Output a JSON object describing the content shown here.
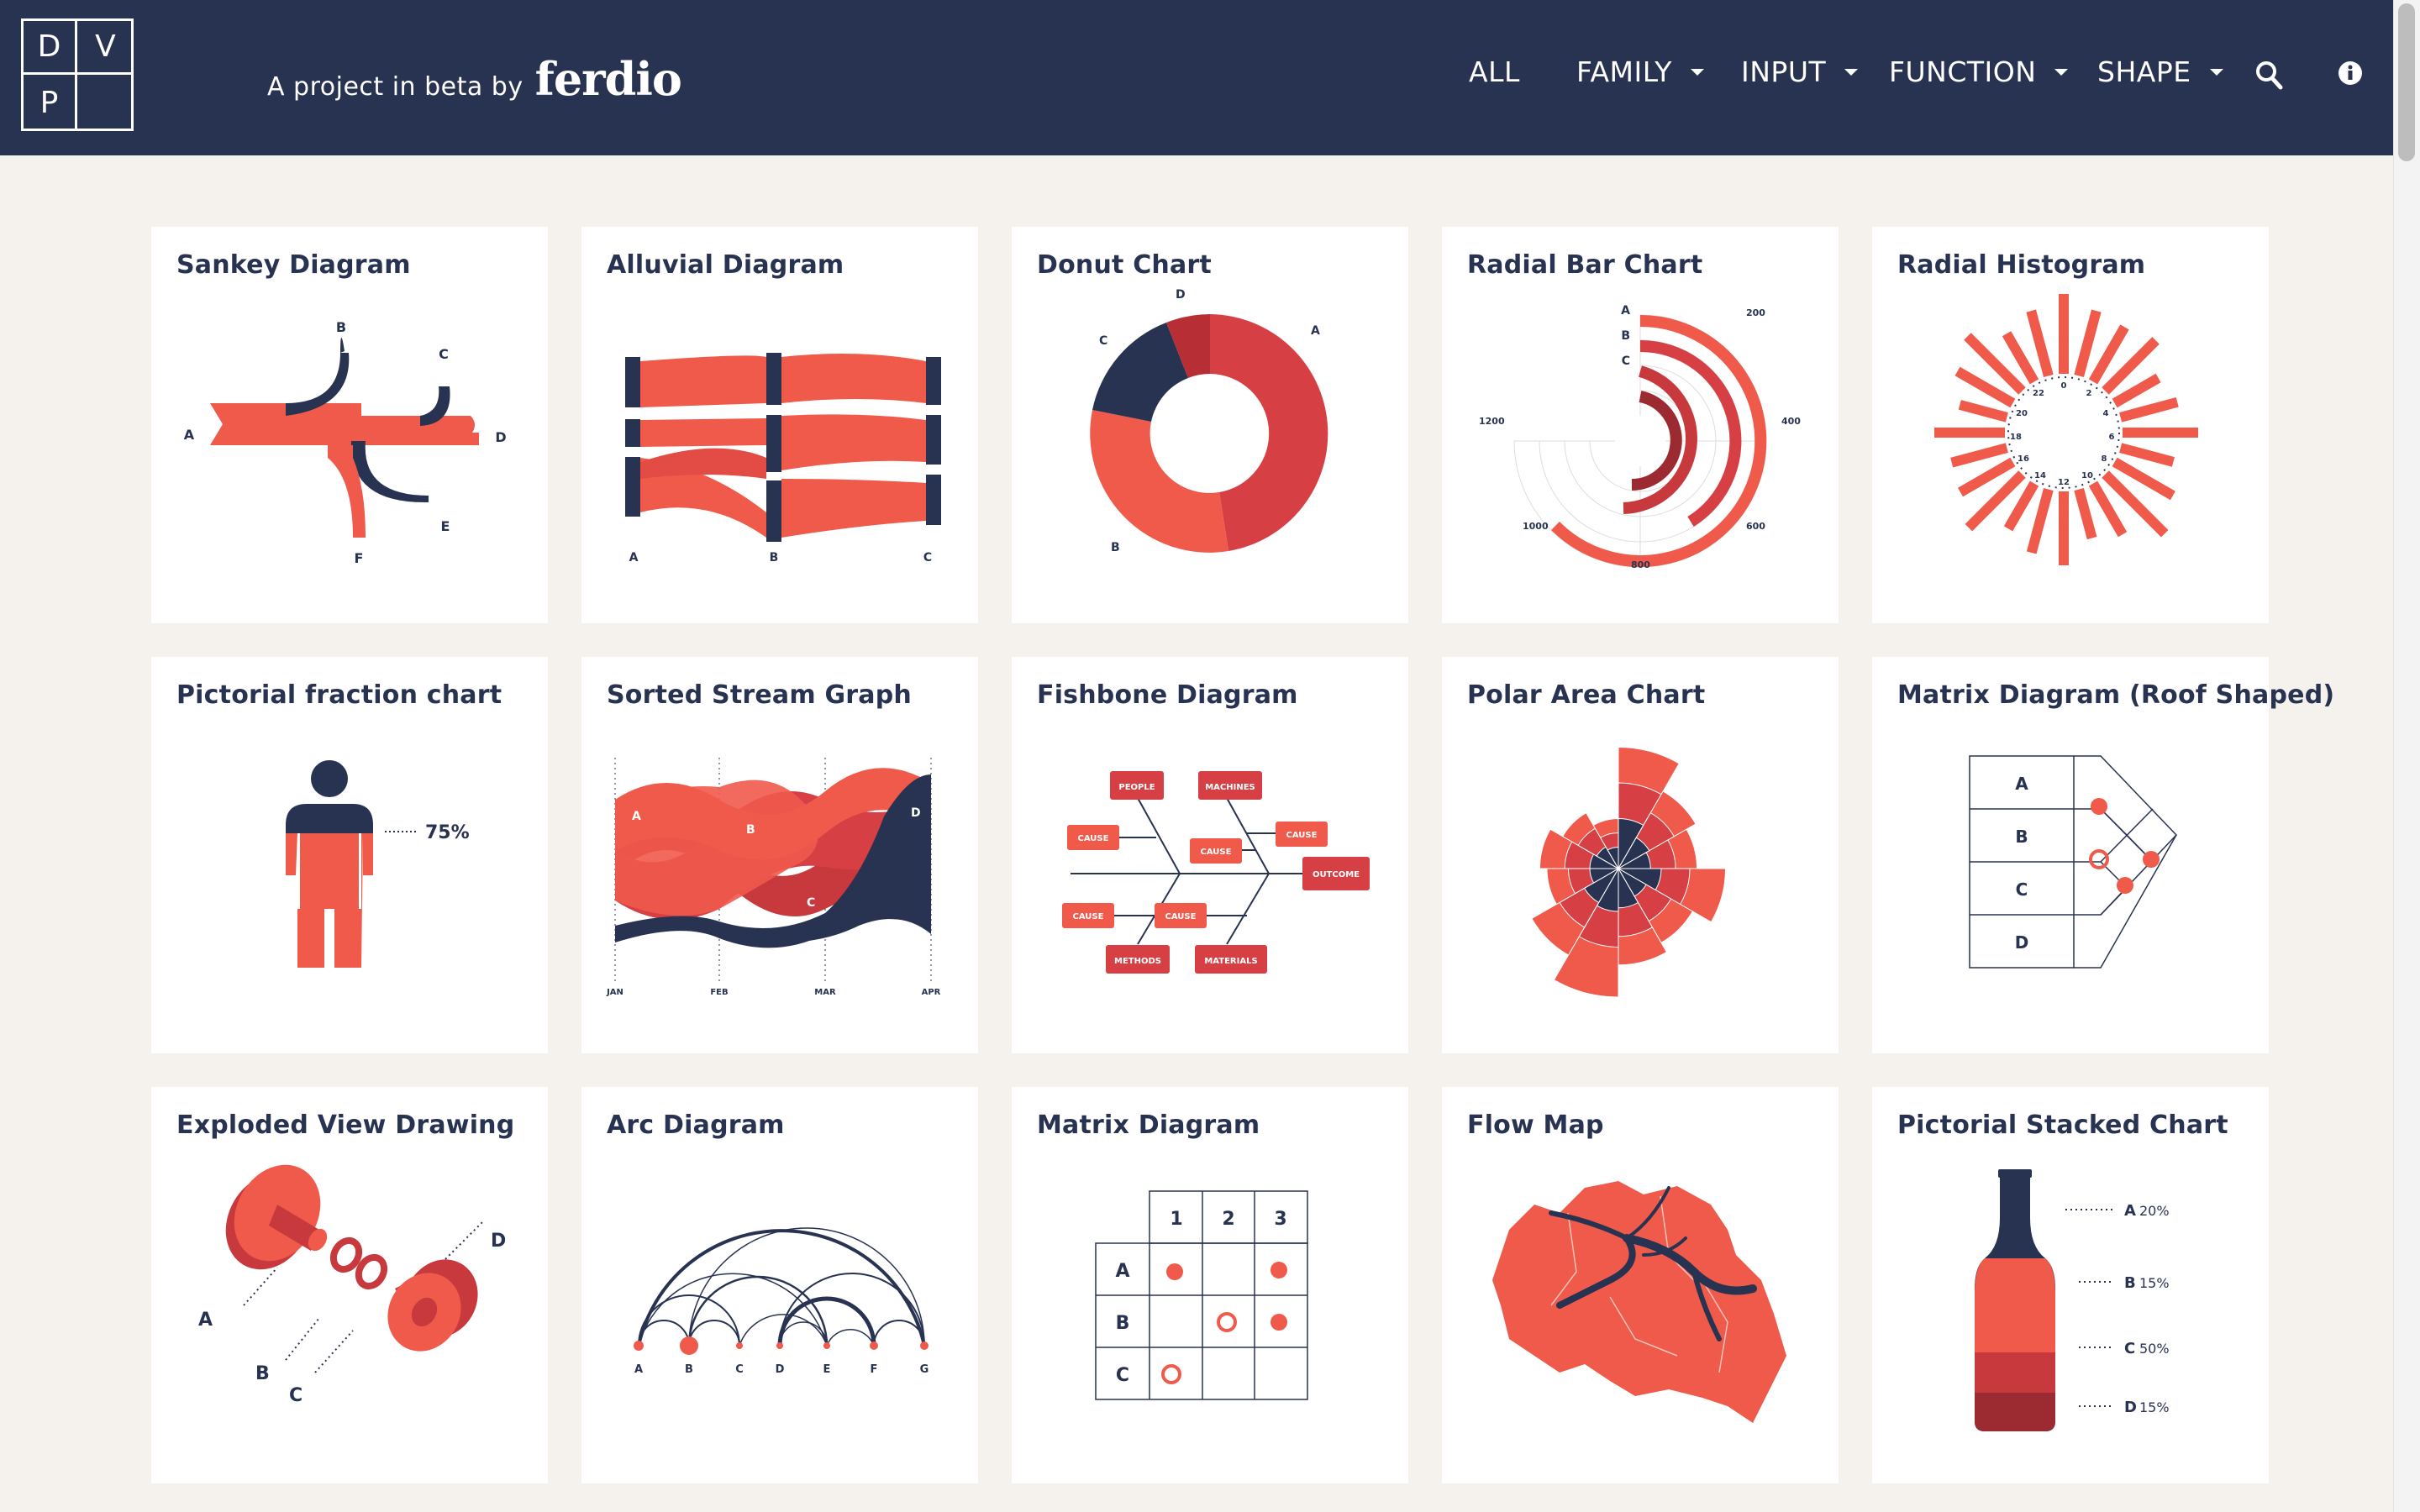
{
  "header": {
    "logo": [
      "D",
      "V",
      "P"
    ],
    "tagline_prefix": "A project in beta by",
    "tagline_brand": "ferdio",
    "nav": [
      {
        "label": "ALL",
        "dropdown": false
      },
      {
        "label": "FAMILY",
        "dropdown": true
      },
      {
        "label": "INPUT",
        "dropdown": true
      },
      {
        "label": "FUNCTION",
        "dropdown": true
      },
      {
        "label": "SHAPE",
        "dropdown": true
      }
    ],
    "search_icon": "search-icon",
    "info_icon": "info-icon"
  },
  "colors": {
    "navy": "#283251",
    "red": "#ef5a4b",
    "dark_red": "#c8393e",
    "background": "#f5f1ec"
  },
  "cards": [
    {
      "title": "Sankey Diagram",
      "labels": [
        "A",
        "B",
        "C",
        "D",
        "E",
        "F"
      ]
    },
    {
      "title": "Alluvial Diagram",
      "labels": [
        "A",
        "B",
        "C"
      ]
    },
    {
      "title": "Donut Chart",
      "labels": [
        "A",
        "B",
        "C",
        "D"
      ]
    },
    {
      "title": "Radial Bar Chart",
      "labels": [
        "A",
        "B",
        "C"
      ],
      "ticks": [
        "200",
        "400",
        "600",
        "800",
        "1000",
        "1200"
      ]
    },
    {
      "title": "Radial Histogram",
      "ticks": [
        "0",
        "2",
        "4",
        "6",
        "8",
        "10",
        "12",
        "14",
        "16",
        "18",
        "20",
        "22"
      ]
    },
    {
      "title": "Pictorial fraction chart",
      "value_label": "75%"
    },
    {
      "title": "Sorted Stream Graph",
      "labels": [
        "A",
        "B",
        "C",
        "D"
      ],
      "months": [
        "JAN",
        "FEB",
        "MAR",
        "APR"
      ]
    },
    {
      "title": "Fishbone Diagram",
      "boxes": [
        "PEOPLE",
        "MACHINES",
        "CAUSE",
        "CAUSE",
        "CAUSE",
        "OUTCOME",
        "CAUSE",
        "CAUSE",
        "METHODS",
        "MATERIALS"
      ]
    },
    {
      "title": "Polar Area Chart"
    },
    {
      "title": "Matrix Diagram (Roof Shaped)",
      "labels": [
        "A",
        "B",
        "C",
        "D"
      ]
    },
    {
      "title": "Exploded View Drawing",
      "labels": [
        "A",
        "B",
        "C",
        "D"
      ]
    },
    {
      "title": "Arc Diagram",
      "labels": [
        "A",
        "B",
        "C",
        "D",
        "E",
        "F",
        "G"
      ]
    },
    {
      "title": "Matrix Diagram",
      "cols": [
        "1",
        "2",
        "3"
      ],
      "rows": [
        "A",
        "B",
        "C"
      ]
    },
    {
      "title": "Flow Map"
    },
    {
      "title": "Pictorial Stacked Chart",
      "items": [
        {
          "letter": "A",
          "pct": "20%"
        },
        {
          "letter": "B",
          "pct": "15%"
        },
        {
          "letter": "C",
          "pct": "50%"
        },
        {
          "letter": "D",
          "pct": "15%"
        }
      ]
    }
  ]
}
